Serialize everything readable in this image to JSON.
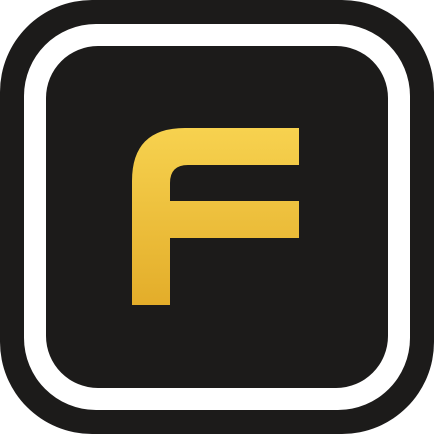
{
  "app_icon": {
    "icon": "letter-f-logo-icon",
    "glyph": "F",
    "colors": {
      "outer_frame": "#1c1b1a",
      "gap_ring": "#ffffff",
      "inner_tile": "#1c1b1a",
      "glyph_top": "#f7d24f",
      "glyph_bottom": "#e3ad2a"
    }
  }
}
